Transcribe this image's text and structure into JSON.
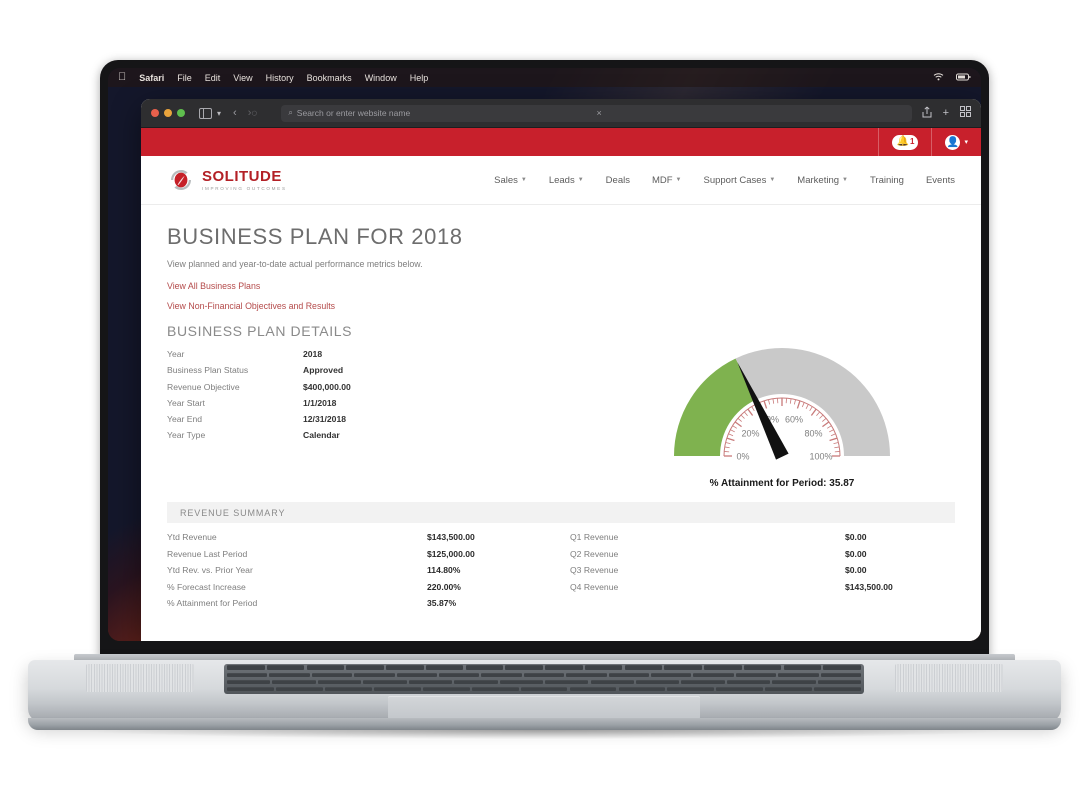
{
  "os": {
    "menubar": {
      "apple_icon": "apple-icon",
      "items": [
        "Safari",
        "File",
        "Edit",
        "View",
        "History",
        "Bookmarks",
        "Window",
        "Help"
      ],
      "status_icons": [
        "wifi-icon",
        "battery-icon"
      ]
    }
  },
  "browser": {
    "traffic_lights": [
      "close",
      "minimize",
      "zoom"
    ],
    "sidebar_icon": "sidebar-toggle-icon",
    "sidebar_caret": "▾",
    "back_arrow": "‹",
    "forward_arrow": "›",
    "shield_icon": "privacy-shield-icon",
    "search_icon": "⌕",
    "address_placeholder": "Search or enter website name",
    "clear_icon": "×",
    "share_icon": "⇪",
    "new_tab_icon": "+",
    "tabs_icon": "⊞"
  },
  "topbar": {
    "notification_icon": "bell-icon",
    "notification_count": "1",
    "user_icon": "user-icon",
    "user_caret": "▾"
  },
  "site": {
    "logo_name": "SOLITUDE",
    "logo_tagline": "IMPROVING OUTCOMES",
    "brand_red": "#c8202c",
    "nav": [
      {
        "label": "Sales",
        "has_caret": true
      },
      {
        "label": "Leads",
        "has_caret": true
      },
      {
        "label": "Deals",
        "has_caret": false
      },
      {
        "label": "MDF",
        "has_caret": true
      },
      {
        "label": "Support Cases",
        "has_caret": true
      },
      {
        "label": "Marketing",
        "has_caret": true
      },
      {
        "label": "Training",
        "has_caret": false
      },
      {
        "label": "Events",
        "has_caret": false
      }
    ]
  },
  "page": {
    "title": "BUSINESS PLAN FOR 2018",
    "subtitle": "View planned and year-to-date actual performance metrics below.",
    "links": [
      "View All Business Plans",
      "View Non-Financial Objectives and Results"
    ],
    "details_heading": "BUSINESS PLAN DETAILS",
    "details": [
      {
        "label": "Year",
        "value": "2018"
      },
      {
        "label": "Business Plan Status",
        "value": "Approved"
      },
      {
        "label": "Revenue Objective",
        "value": "$400,000.00"
      },
      {
        "label": "Year Start",
        "value": "1/1/2018"
      },
      {
        "label": "Year End",
        "value": "12/31/2018"
      },
      {
        "label": "Year Type",
        "value": "Calendar"
      }
    ],
    "revenue_heading": "REVENUE SUMMARY",
    "revenue_left": [
      {
        "label": "Ytd Revenue",
        "value": "$143,500.00"
      },
      {
        "label": "Revenue Last Period",
        "value": "$125,000.00"
      },
      {
        "label": "Ytd Rev. vs. Prior Year",
        "value": "114.80%"
      },
      {
        "label": "% Forecast Increase",
        "value": "220.00%"
      },
      {
        "label": "% Attainment for Period",
        "value": "35.87%"
      }
    ],
    "revenue_right": [
      {
        "label": "Q1 Revenue",
        "value": "$0.00"
      },
      {
        "label": "Q2 Revenue",
        "value": "$0.00"
      },
      {
        "label": "Q3 Revenue",
        "value": "$0.00"
      },
      {
        "label": "Q4 Revenue",
        "value": "$143,500.00"
      }
    ]
  },
  "chart_data": {
    "type": "gauge",
    "title": "% Attainment for Period: 35.87",
    "value": 35.87,
    "min": 0,
    "max": 100,
    "unit": "%",
    "tick_labels": [
      "0%",
      "20%",
      "40%",
      "60%",
      "80%",
      "100%"
    ],
    "tick_values": [
      0,
      20,
      40,
      60,
      80,
      100
    ],
    "bands": [
      {
        "from": 0,
        "to": 35.87,
        "color": "#7fb24f",
        "name": "attained"
      },
      {
        "from": 35.87,
        "to": 100,
        "color": "#c9c9c9",
        "name": "remaining"
      }
    ],
    "needle_color": "#111111",
    "dial_tick_color": "#c87a7a",
    "dial_face_color": "#ffffff",
    "label_color": "#808080",
    "start_angle": 180,
    "end_angle": 0
  }
}
